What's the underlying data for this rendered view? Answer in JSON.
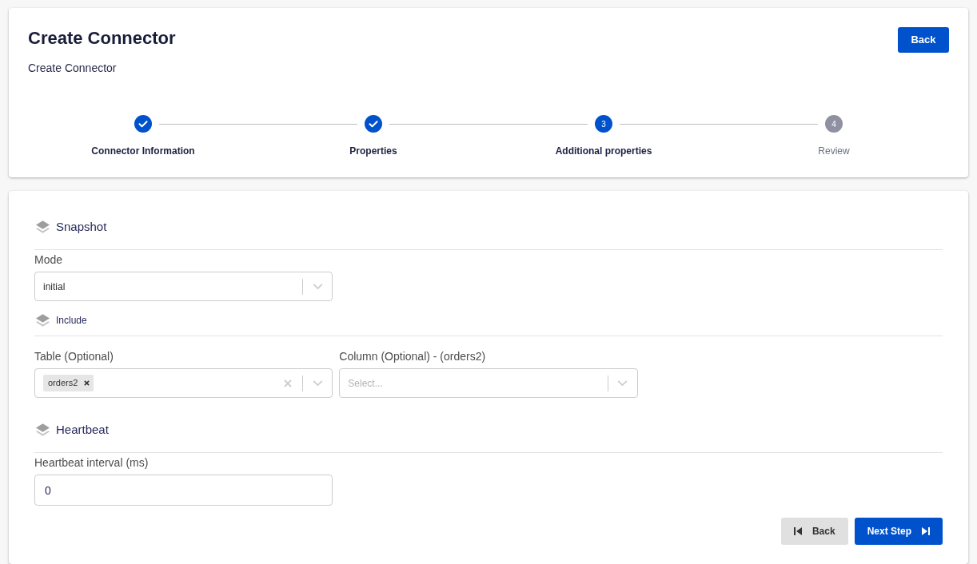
{
  "header": {
    "title": "Create Connector",
    "subtitle": "Create Connector",
    "back_button": "Back"
  },
  "stepper": {
    "steps": [
      {
        "label": "Connector Information",
        "completed": true,
        "selected": false
      },
      {
        "label": "Properties",
        "completed": true,
        "selected": false
      },
      {
        "label": "Additional properties",
        "completed": false,
        "selected": true,
        "number": "3"
      },
      {
        "label": "Review",
        "completed": false,
        "selected": false,
        "number": "4"
      }
    ]
  },
  "form": {
    "sections": [
      {
        "title": "Snapshot",
        "kind": "section",
        "fields": [
          {
            "kind": "select",
            "label": "Mode",
            "value": "initial"
          }
        ]
      },
      {
        "title": "Include",
        "kind": "subsection",
        "fields": [
          {
            "kind": "multiselect",
            "label": "Table (Optional)",
            "chips": [
              "orders2"
            ]
          },
          {
            "kind": "select",
            "label": "Column (Optional) - (orders2)",
            "placeholder": "Select..."
          }
        ]
      },
      {
        "title": "Heartbeat",
        "kind": "section",
        "fields": [
          {
            "kind": "text",
            "label": "Heartbeat interval (ms)",
            "value": "0"
          }
        ]
      }
    ]
  },
  "footer": {
    "buttons": [
      {
        "label": "Back",
        "kind": "secondary"
      },
      {
        "label": "Next Step",
        "kind": "primary"
      }
    ]
  }
}
